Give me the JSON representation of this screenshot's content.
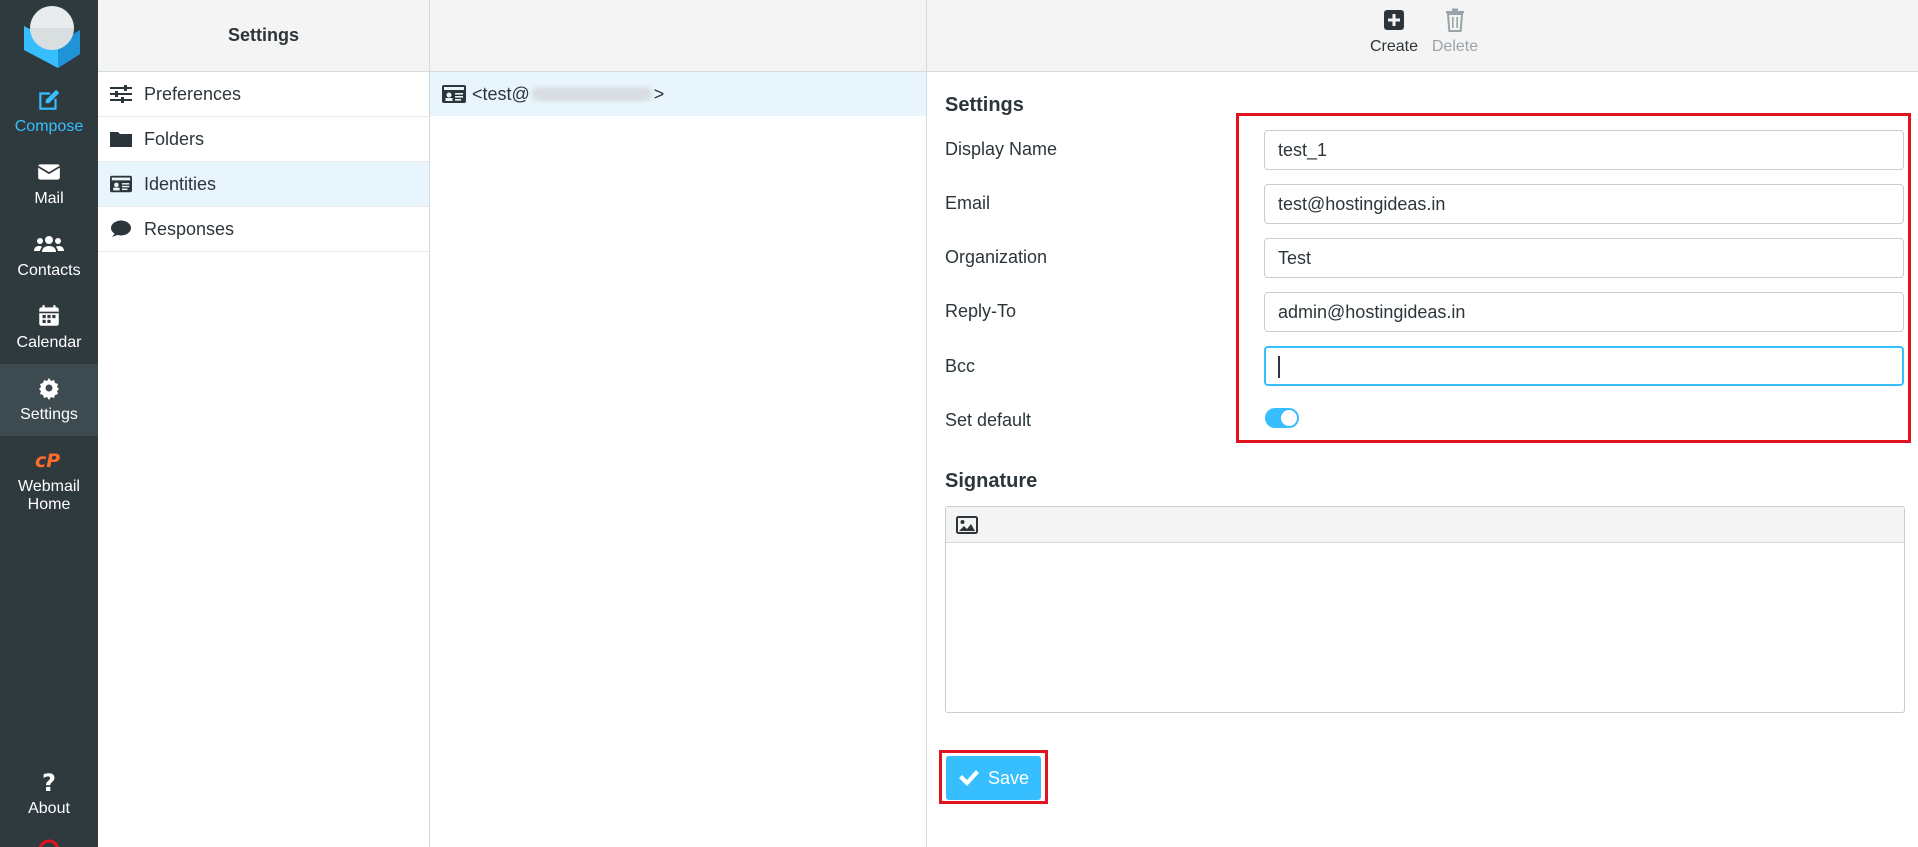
{
  "nav": {
    "compose": "Compose",
    "mail": "Mail",
    "contacts": "Contacts",
    "calendar": "Calendar",
    "settings": "Settings",
    "webmail_home": "Webmail Home",
    "about": "About"
  },
  "sections": {
    "header": "Settings",
    "items": [
      {
        "label": "Preferences",
        "icon": "sliders-icon"
      },
      {
        "label": "Folders",
        "icon": "folder-icon"
      },
      {
        "label": "Identities",
        "icon": "id-card-icon"
      },
      {
        "label": "Responses",
        "icon": "comment-icon"
      }
    ]
  },
  "identities": {
    "row_prefix": "<test@",
    "row_suffix": ">"
  },
  "toolbar": {
    "create": "Create",
    "delete": "Delete"
  },
  "form": {
    "settings_title": "Settings",
    "display_name_label": "Display Name",
    "display_name_value": "test_1",
    "email_label": "Email",
    "email_value": "test@hostingideas.in",
    "organization_label": "Organization",
    "organization_value": "Test",
    "reply_to_label": "Reply-To",
    "reply_to_value": "admin@hostingideas.in",
    "bcc_label": "Bcc",
    "bcc_value": "",
    "set_default_label": "Set default",
    "set_default_on": true,
    "signature_title": "Signature",
    "save_label": "Save"
  },
  "colors": {
    "accent": "#37beff",
    "nav_bg": "#2f3a3f",
    "highlight": "#e0141e",
    "cpanel": "#ff6c2c"
  }
}
